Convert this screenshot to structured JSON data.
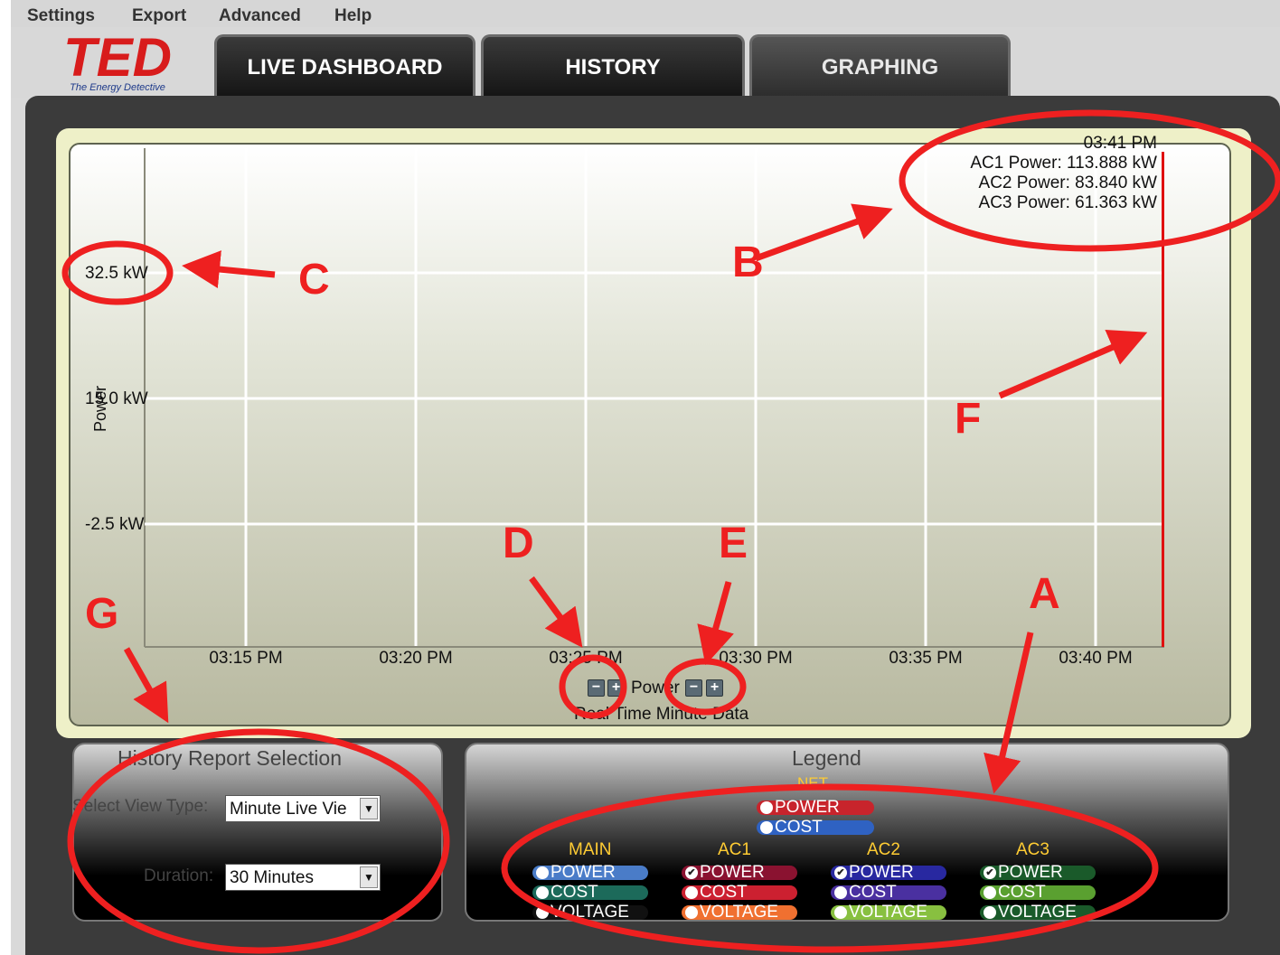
{
  "menu": {
    "items": [
      "Settings",
      "Export",
      "Advanced",
      "Help"
    ]
  },
  "logo": {
    "text": "TED",
    "tagline": "The Energy Detective"
  },
  "tabs": [
    {
      "label": "LIVE DASHBOARD",
      "active": false
    },
    {
      "label": "HISTORY",
      "active": false
    },
    {
      "label": "GRAPHING",
      "active": true
    }
  ],
  "chart": {
    "ylabel": "Power",
    "caption": "Real Time Minute Data",
    "zoom_label": "Power",
    "tooltip": {
      "time": "03:41 PM",
      "lines": [
        "AC1 Power: 113.888 kW",
        "AC2 Power: 83.840 kW",
        "AC3 Power: 61.363 kW"
      ]
    }
  },
  "chart_data": {
    "type": "line",
    "title": "",
    "caption": "Real Time Minute Data",
    "ylabel": "Power",
    "y_ticks": [
      "32.5 kW",
      "15.0 kW",
      "-2.5 kW"
    ],
    "y_tick_values": [
      32.5,
      15.0,
      -2.5
    ],
    "x_ticks": [
      "03:15 PM",
      "03:20 PM",
      "03:25 PM",
      "03:30 PM",
      "03:35 PM",
      "03:40 PM"
    ],
    "grid": true,
    "series": [
      {
        "name": "AC1 Power",
        "values": [
          113.888
        ],
        "color": "#e01010"
      }
    ]
  },
  "history": {
    "title": "History Report Selection",
    "view_type_label": "Select View Type:",
    "view_type_value": "Minute Live Vie",
    "duration_label": "Duration:",
    "duration_value": "30 Minutes"
  },
  "legend": {
    "title": "Legend",
    "net": {
      "label": "NET",
      "items": [
        {
          "label": "POWER",
          "color": "#c8242c",
          "checked": false
        },
        {
          "label": "COST",
          "color": "#2f62c2",
          "checked": false
        }
      ]
    },
    "groups": [
      {
        "label": "MAIN",
        "items": [
          {
            "label": "POWER",
            "color": "#4a7cc8",
            "checked": false
          },
          {
            "label": "COST",
            "color": "#1c6a5a",
            "checked": false
          },
          {
            "label": "VOLTAGE",
            "color": "#111111",
            "checked": false
          }
        ]
      },
      {
        "label": "AC1",
        "items": [
          {
            "label": "POWER",
            "color": "#8a1230",
            "checked": true
          },
          {
            "label": "COST",
            "color": "#cc2030",
            "checked": false
          },
          {
            "label": "VOLTAGE",
            "color": "#f07030",
            "checked": false
          }
        ]
      },
      {
        "label": "AC2",
        "items": [
          {
            "label": "POWER",
            "color": "#2828a0",
            "checked": true
          },
          {
            "label": "COST",
            "color": "#4a30a0",
            "checked": false
          },
          {
            "label": "VOLTAGE",
            "color": "#88c040",
            "checked": false
          }
        ]
      },
      {
        "label": "AC3",
        "items": [
          {
            "label": "POWER",
            "color": "#1a5a2a",
            "checked": true
          },
          {
            "label": "COST",
            "color": "#5aa030",
            "checked": false
          },
          {
            "label": "VOLTAGE",
            "color": "#1a5a2a",
            "checked": false
          }
        ]
      }
    ]
  },
  "annotations": [
    "A",
    "B",
    "C",
    "D",
    "E",
    "F",
    "G"
  ],
  "colors": {
    "annotation": "#ee2020",
    "legend_heading": "#ffcc33",
    "series_line": "#e01010"
  }
}
